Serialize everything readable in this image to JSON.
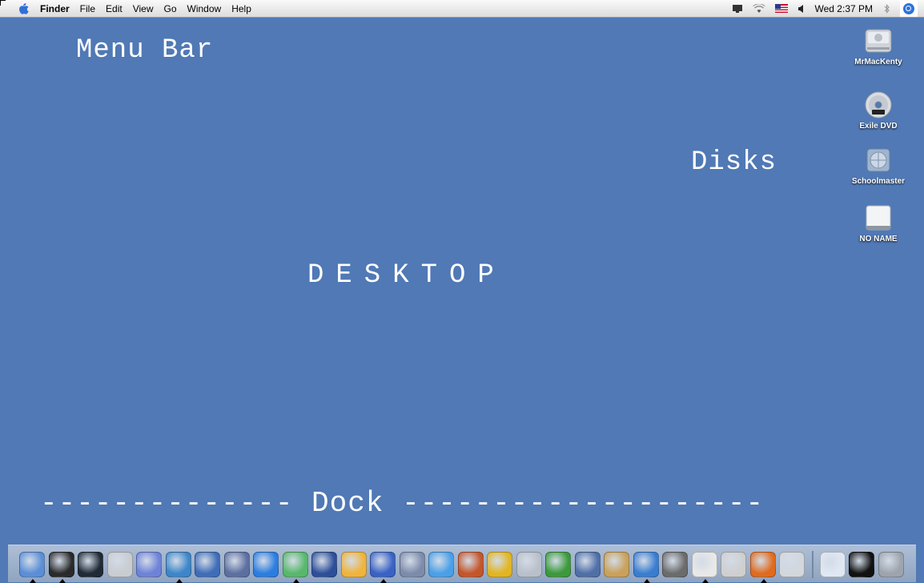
{
  "menubar": {
    "app": "Finder",
    "items": [
      "File",
      "Edit",
      "View",
      "Go",
      "Window",
      "Help"
    ],
    "clock": "Wed 2:37 PM"
  },
  "labels": {
    "menubar": "Menu Bar",
    "disks": "Disks",
    "desktop": "DESKTOP",
    "dock": "-------------- Dock --------------------"
  },
  "disks": [
    {
      "name": "MrMacKenty",
      "icon": "hard-drive-icon"
    },
    {
      "name": "Exile DVD",
      "icon": "dvd-icon"
    },
    {
      "name": "Schoolmaster",
      "icon": "network-volume-icon"
    },
    {
      "name": "NO NAME",
      "icon": "external-drive-icon"
    }
  ],
  "dock": {
    "apps": [
      {
        "icon": "finder-icon",
        "color": "#5b8ed6",
        "running": true
      },
      {
        "icon": "dashboard-icon",
        "color": "#2a2a2a",
        "running": true
      },
      {
        "icon": "terminal-icon",
        "color": "#1f2a35",
        "running": false
      },
      {
        "icon": "photo-booth-icon",
        "color": "#c9ccd1",
        "running": false
      },
      {
        "icon": "bbedit-icon",
        "color": "#6e83d8",
        "running": false
      },
      {
        "icon": "transmit-icon",
        "color": "#3c86c9",
        "running": true
      },
      {
        "icon": "fetch-icon",
        "color": "#3f6db8",
        "running": false
      },
      {
        "icon": "xcode-icon",
        "color": "#5c6fa0",
        "running": false
      },
      {
        "icon": "network-icon",
        "color": "#2b7de0",
        "running": false
      },
      {
        "icon": "itunes-icon",
        "color": "#57b86a",
        "running": true
      },
      {
        "icon": "imovie-icon",
        "color": "#2d4f99",
        "running": false
      },
      {
        "icon": "idvd-icon",
        "color": "#f0b43b",
        "running": false
      },
      {
        "icon": "word-icon",
        "color": "#3a62c4",
        "running": true
      },
      {
        "icon": "automator-icon",
        "color": "#7d8bab",
        "running": false
      },
      {
        "icon": "safari-icon",
        "color": "#4aa0e8",
        "running": false
      },
      {
        "icon": "iphoto-icon",
        "color": "#c4562b",
        "running": false
      },
      {
        "icon": "sunflower-icon",
        "color": "#e2b520",
        "running": false
      },
      {
        "icon": "preview-icon",
        "color": "#b9c0ca",
        "running": false
      },
      {
        "icon": "grapher-icon",
        "color": "#3b9a3b",
        "running": false
      },
      {
        "icon": "keynote-icon",
        "color": "#4f6fa8",
        "running": false
      },
      {
        "icon": "address-book-icon",
        "color": "#c9a15a",
        "running": false
      },
      {
        "icon": "thunderbird-icon",
        "color": "#3a7dd0",
        "running": true
      },
      {
        "icon": "garageband-icon",
        "color": "#6b6b6b",
        "running": false
      },
      {
        "icon": "ical-icon",
        "color": "#e8e8e8",
        "running": true
      },
      {
        "icon": "script-editor-icon",
        "color": "#cfcfcf",
        "running": false
      },
      {
        "icon": "firefox-icon",
        "color": "#e06b1f",
        "running": true
      },
      {
        "icon": "printer-icon",
        "color": "#d3d7dc",
        "running": false
      }
    ],
    "right": [
      {
        "icon": "desktop-stack-icon",
        "color": "#dfe8f3"
      },
      {
        "icon": "minimized-window-icon",
        "color": "#111111"
      },
      {
        "icon": "trash-icon",
        "color": "#9da4ad"
      }
    ]
  },
  "colors": {
    "desktop": "#5079b5",
    "label": "#ffffff"
  }
}
